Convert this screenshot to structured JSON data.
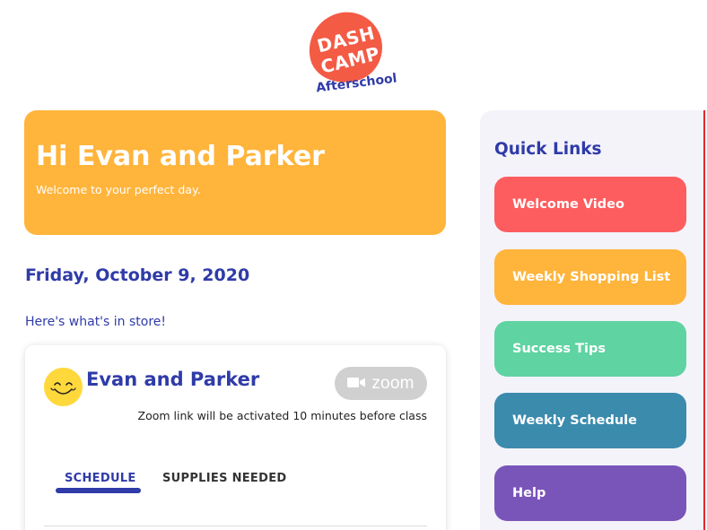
{
  "logo": {
    "line1": "DASH",
    "line2": "CAMP",
    "sub": "Afterschool"
  },
  "hero": {
    "title": "Hi Evan and Parker",
    "subtitle": "Welcome to your perfect day."
  },
  "date": "Friday, October 9, 2020",
  "intro": "Here's what's in store!",
  "class_card": {
    "name": "Evan and Parker",
    "zoom_label": "zoom",
    "zoom_note": "Zoom link will be activated 10 minutes before class",
    "tabs": [
      {
        "label": "SCHEDULE",
        "active": true
      },
      {
        "label": "SUPPLIES NEEDED",
        "active": false
      }
    ]
  },
  "quick_links": {
    "title": "Quick Links",
    "items": [
      {
        "label": "Welcome Video",
        "color": "#fd5d5f"
      },
      {
        "label": "Weekly Shopping List",
        "color": "#ffb43b"
      },
      {
        "label": "Success Tips",
        "color": "#5fd3a2"
      },
      {
        "label": "Weekly Schedule",
        "color": "#3b8bad"
      },
      {
        "label": "Help",
        "color": "#7a55b9"
      }
    ]
  },
  "colors": {
    "brand_blue": "#2f3ba8",
    "brand_orange": "#ffb43b",
    "logo_red": "#f35b45",
    "zoom_gray": "#d0d0d0"
  },
  "icons": {
    "avatar": "smiley-face-icon",
    "zoom": "video-camera-icon"
  }
}
